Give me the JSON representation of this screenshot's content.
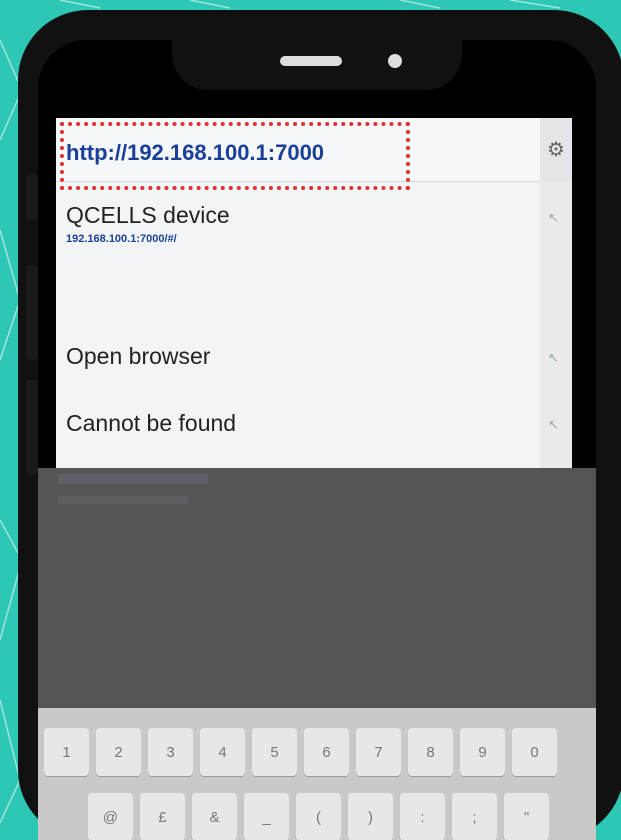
{
  "url_bar": {
    "url": "http://192.168.100.1:7000"
  },
  "suggestions": [
    {
      "title": "QCELLS device",
      "subtitle": "192.168.100.1:7000/#/"
    },
    {
      "title": "Open browser"
    },
    {
      "title": "Cannot be found"
    }
  ],
  "icons": {
    "settings": "gear-icon",
    "fill_arrow": "arrow-up-left-icon"
  },
  "keyboard": {
    "row1": [
      "1",
      "2",
      "3",
      "4",
      "5",
      "6",
      "7",
      "8",
      "9",
      "0"
    ],
    "row2": [
      "@",
      "£",
      "&",
      "_",
      "(",
      ")",
      ":",
      ";",
      "\""
    ]
  },
  "colors": {
    "background": "#2ec6b4",
    "url_text": "#1a3f9b",
    "highlight": "#e03030"
  }
}
